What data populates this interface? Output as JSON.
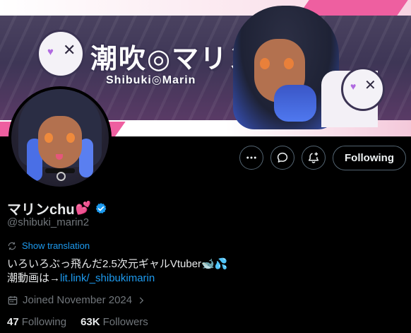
{
  "banner": {
    "logo_text": "潮吹◎マリン",
    "logo_subtext": "Shibuki◎Marin",
    "colors": {
      "pink": "#ee5fa0",
      "navy": "#3b3353",
      "blue_hair": "#4a6fe6"
    }
  },
  "actions": {
    "more_icon": "more-horizontal-icon",
    "message_icon": "message-icon",
    "notify_icon": "notification-bell-plus-icon",
    "follow_label": "Following"
  },
  "profile": {
    "display_name": "マリンchu",
    "name_emoji": "💕",
    "verified_icon": "verified-badge-icon",
    "verified_color": "#1d9bf0",
    "handle": "@shibuki_marin2",
    "translate_label": "Show translation",
    "bio_line1": "いろいろぶっ飛んだ2.5次元ギャルVtuber",
    "bio_line1_emoji": "🐋💦",
    "bio_line2_prefix": "潮動画は→",
    "bio_link": "lit.link/_shibukimarin",
    "joined": "Joined November 2024"
  },
  "stats": {
    "following_count": "47",
    "following_label": "Following",
    "followers_count": "63K",
    "followers_label": "Followers"
  },
  "colors": {
    "accent": "#1d9bf0",
    "muted": "#71767b",
    "text": "#e7e9ea",
    "background": "#000000"
  }
}
